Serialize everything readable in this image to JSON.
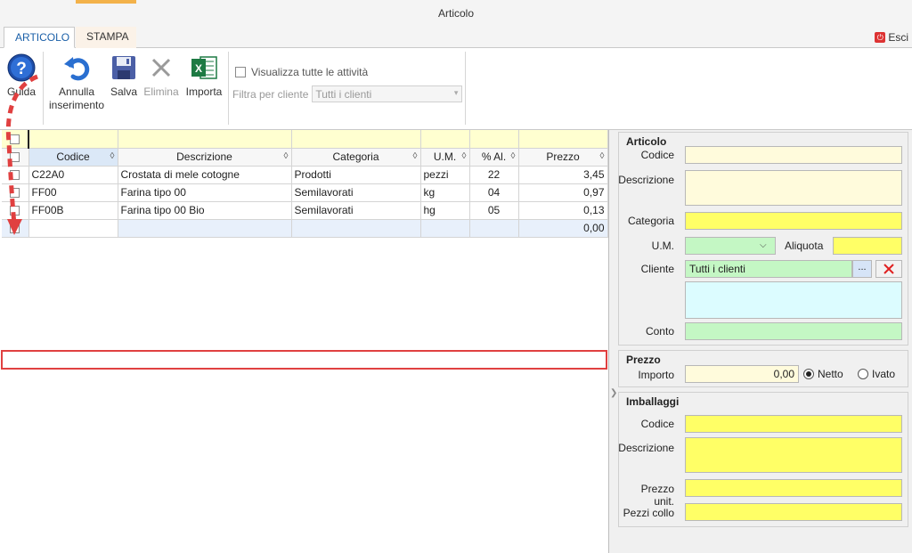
{
  "window": {
    "title": "Articolo"
  },
  "tabs": {
    "articolo": "ARTICOLO",
    "stampa": "STAMPA"
  },
  "exit_label": "Esci",
  "toolbar": {
    "guida": "Guida",
    "annulla_line1": "Annulla",
    "annulla_line2": "inserimento",
    "salva": "Salva",
    "elimina": "Elimina",
    "importa": "Importa",
    "show_all_label": "Visualizza tutte le attività",
    "filter_label": "Filtra per cliente",
    "filter_value": "Tutti i clienti"
  },
  "grid": {
    "columns": [
      "Codice",
      "Descrizione",
      "Categoria",
      "U.M.",
      "% Al.",
      "Prezzo"
    ],
    "rows": [
      {
        "codice": "C22A0",
        "descrizione": "Crostata di mele cotogne",
        "categoria": "Prodotti",
        "um": "pezzi",
        "al": "22",
        "prezzo": "3,45"
      },
      {
        "codice": "FF00",
        "descrizione": "Farina tipo 00",
        "categoria": "Semilavorati",
        "um": "kg",
        "al": "04",
        "prezzo": "0,97"
      },
      {
        "codice": "FF00B",
        "descrizione": "Farina tipo 00 Bio",
        "categoria": "Semilavorati",
        "um": "hg",
        "al": "05",
        "prezzo": "0,13"
      }
    ],
    "new_row_prezzo": "0,00"
  },
  "articolo": {
    "title": "Articolo",
    "codice_label": "Codice",
    "descrizione_label": "Descrizione",
    "categoria_label": "Categoria",
    "um_label": "U.M.",
    "aliquota_label": "Aliquota",
    "cliente_label": "Cliente",
    "cliente_value": "Tutti i clienti",
    "browse_label": "...",
    "conto_label": "Conto"
  },
  "prezzo": {
    "title": "Prezzo",
    "importo_label": "Importo",
    "importo_value": "0,00",
    "netto_label": "Netto",
    "ivato_label": "Ivato"
  },
  "imballaggi": {
    "title": "Imballaggi",
    "codice_label": "Codice",
    "descrizione_label": "Descrizione",
    "prezzo_unit_label": "Prezzo unit.",
    "pezzi_collo_label": "Pezzi collo"
  }
}
